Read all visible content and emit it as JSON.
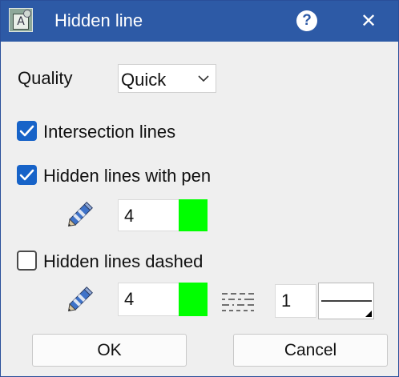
{
  "window": {
    "title": "Hidden line",
    "help_glyph": "?",
    "close_glyph": "✕",
    "app_icon_letter": "A"
  },
  "quality": {
    "label": "Quality",
    "selected": "Quick"
  },
  "intersection_lines": {
    "label": "Intersection lines",
    "checked": true
  },
  "hidden_with_pen": {
    "label": "Hidden lines with pen",
    "checked": true,
    "pen": "4",
    "color": "#00ff00"
  },
  "hidden_dashed": {
    "label": "Hidden lines dashed",
    "checked": false,
    "pen": "4",
    "color": "#00ff00",
    "linetype": "1"
  },
  "buttons": {
    "ok": "OK",
    "cancel": "Cancel"
  }
}
